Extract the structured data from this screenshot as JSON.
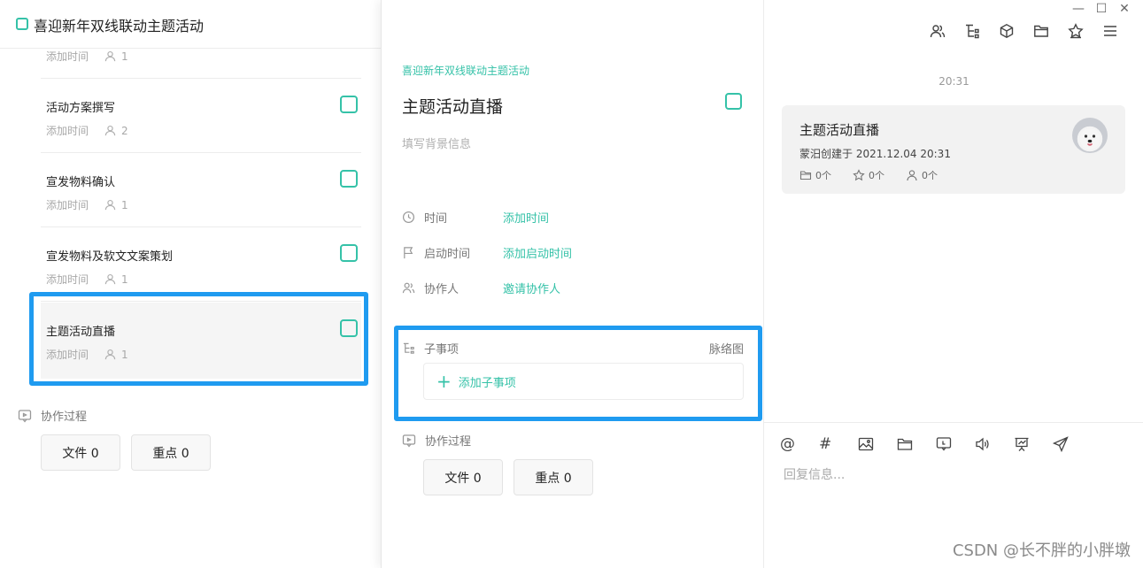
{
  "left": {
    "project_title": "喜迎新年双线联动主题活动",
    "tasks": [
      {
        "name": "",
        "time": "添加时间",
        "count": "1"
      },
      {
        "name": "活动方案撰写",
        "time": "添加时间",
        "count": "2"
      },
      {
        "name": "宣发物料确认",
        "time": "添加时间",
        "count": "1"
      },
      {
        "name": "宣发物料及软文文案策划",
        "time": "添加时间",
        "count": "1"
      },
      {
        "name": "主题活动直播",
        "time": "添加时间",
        "count": "1"
      }
    ],
    "process_label": "协作过程",
    "file_btn": "文件 0",
    "key_btn": "重点 0"
  },
  "mid": {
    "breadcrumb": "喜迎新年双线联动主题活动",
    "title": "主题活动直播",
    "bg_placeholder": "填写背景信息",
    "fields": [
      {
        "label": "时间",
        "value": "添加时间",
        "icon": "clock-icon"
      },
      {
        "label": "启动时间",
        "value": "添加启动时间",
        "icon": "flag-icon"
      },
      {
        "label": "协作人",
        "value": "邀请协作人",
        "icon": "users-icon"
      }
    ],
    "subitems_label": "子事项",
    "mindmap_label": "脉络图",
    "add_subitem": "添加子事项",
    "process_label": "协作过程",
    "file_btn": "文件 0",
    "key_btn": "重点 0"
  },
  "right": {
    "window_controls": [
      "—",
      "☐",
      "✕"
    ],
    "toolbar_icons": [
      "users-icon",
      "tree-icon",
      "cube-icon",
      "folder-icon",
      "star-icon",
      "menu-icon"
    ],
    "time": "20:31",
    "card": {
      "title": "主题活动直播",
      "creator": "蒙汨创建于",
      "created_at": "2021.12.04 20:31",
      "folder_count": "0个",
      "star_count": "0个",
      "user_count": "0个"
    },
    "compose_icons": [
      "at-icon",
      "hash-icon",
      "image-icon",
      "folder-icon",
      "comment-icon",
      "speaker-icon",
      "presentation-icon",
      "send-icon"
    ],
    "reply_placeholder": "回复信息..."
  },
  "watermark": "CSDN @长不胖的小胖墩",
  "colors": {
    "accent": "#35c2a8",
    "highlight": "#1f9bf0"
  }
}
